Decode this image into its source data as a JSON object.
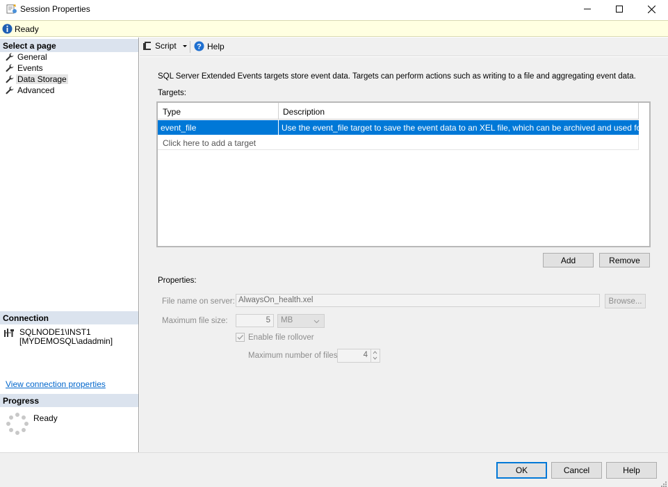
{
  "window": {
    "title": "Session Properties"
  },
  "status": {
    "text": "Ready"
  },
  "left": {
    "select_header": "Select a page",
    "pages": [
      {
        "label": "General"
      },
      {
        "label": "Events"
      },
      {
        "label": "Data Storage"
      },
      {
        "label": "Advanced"
      }
    ],
    "connection_header": "Connection",
    "connection_server": "SQLNODE1\\INST1",
    "connection_user": "[MYDEMOSQL\\adadmin]",
    "connection_link": "View connection properties",
    "progress_header": "Progress",
    "progress_status": "Ready"
  },
  "toolbar": {
    "script_label": "Script",
    "help_label": "Help"
  },
  "main": {
    "description": "SQL Server Extended Events targets store event data. Targets can perform actions such as writing to a file and aggregating event data.",
    "targets_label": "Targets:",
    "columns": [
      "Type",
      "Description"
    ],
    "rows": [
      {
        "type": "event_file",
        "description": "Use the event_file target to save the event data to an XEL file, which can be archived and used for later an..."
      }
    ],
    "add_target_text": "Click here to add a target",
    "add_button": "Add",
    "remove_button": "Remove",
    "properties_label": "Properties:",
    "file_name_label": "File name on server:",
    "file_name_value": "AlwaysOn_health.xel",
    "browse_button": "Browse...",
    "max_size_label": "Maximum file size:",
    "max_size_value": "5",
    "max_size_unit": "MB",
    "rollover_label": "Enable file rollover",
    "max_files_label": "Maximum number of files:",
    "max_files_value": "4"
  },
  "footer": {
    "ok": "OK",
    "cancel": "Cancel",
    "help": "Help"
  }
}
